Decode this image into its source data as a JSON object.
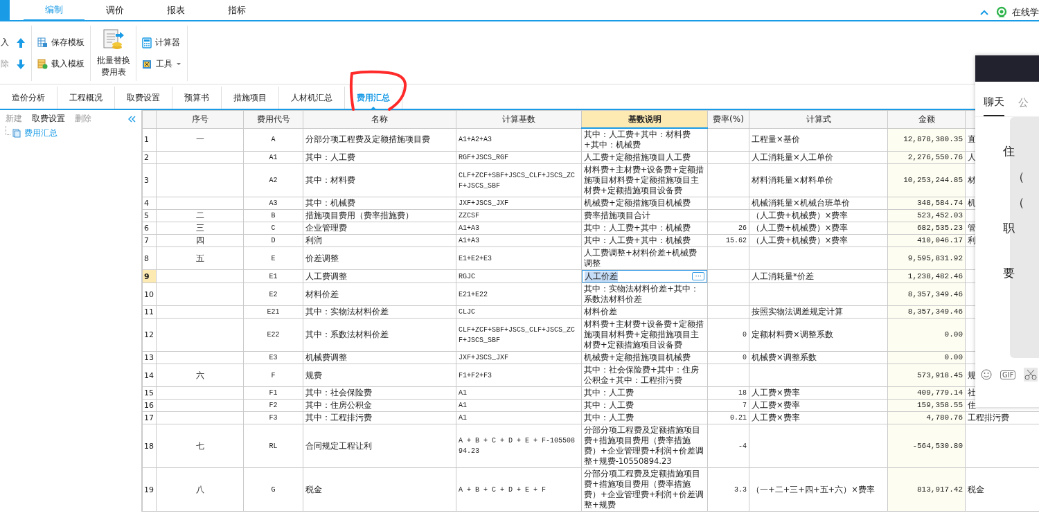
{
  "menu_tabs": [
    {
      "label": "编制",
      "selected": true
    },
    {
      "label": "调价",
      "selected": false
    },
    {
      "label": "报表",
      "selected": false
    },
    {
      "label": "指标",
      "selected": false
    }
  ],
  "online_label": "在线学",
  "toolbar": {
    "insert": {
      "label": "入",
      "disabled": false
    },
    "delete": {
      "label": "除",
      "disabled": true
    },
    "save_template": "保存模板",
    "load_template": "载入模板",
    "batch_replace": [
      "批量替换",
      "费用表"
    ],
    "calculator": "计算器",
    "tools": "工具"
  },
  "view_tabs": [
    {
      "label": "造价分析",
      "selected": false
    },
    {
      "label": "工程概况",
      "selected": false
    },
    {
      "label": "取费设置",
      "selected": false
    },
    {
      "label": "预算书",
      "selected": false
    },
    {
      "label": "措施项目",
      "selected": false
    },
    {
      "label": "人材机汇总",
      "selected": false
    },
    {
      "label": "费用汇总",
      "selected": true
    }
  ],
  "left_panel": {
    "actions": [
      {
        "label": "新建",
        "disabled": true
      },
      {
        "label": "取费设置",
        "disabled": false
      },
      {
        "label": "删除",
        "disabled": true
      }
    ],
    "tree": [
      {
        "label": "费用汇总",
        "selected": true
      }
    ]
  },
  "table": {
    "more_button_label": "···",
    "columns": [
      {
        "label": "序号",
        "selected": false
      },
      {
        "label": "费用代号",
        "selected": false
      },
      {
        "label": "名称",
        "selected": false
      },
      {
        "label": "计算基数",
        "selected": false
      },
      {
        "label": "基数说明",
        "selected": true
      },
      {
        "label": "费率(%)",
        "selected": false
      },
      {
        "label": "计算式",
        "selected": false
      },
      {
        "label": "金额",
        "selected": false
      }
    ],
    "rows": [
      {
        "no": "1",
        "seq": "一",
        "code": "A",
        "name": "分部分项工程费及定额措施项目费",
        "base": "A1+A2+A3",
        "base_desc": "其中：人工费+其中：材料费+其中：机械费",
        "formula": "工程量×基价",
        "amount": "12,878,380.35",
        "column_9": "直",
        "selected": false
      },
      {
        "no": "2",
        "code": "A1",
        "name": "其中：人工费",
        "base": "RGF+JSCS_RGF",
        "base_desc": "人工费+定额措施项目人工费",
        "formula": "人工消耗量×人工单价",
        "amount": "2,276,550.76",
        "column_9": "人",
        "selected": false
      },
      {
        "no": "3",
        "code": "A2",
        "name": "其中：材料费",
        "base": "CLF+ZCF+SBF+JSCS_CLF+JSCS_ZCF+JSCS_SBF",
        "base_desc": "材料费+主材费+设备费+定额措施项目材料费+定额措施项目主材费+定额措施项目设备费",
        "formula": "材料消耗量×材料单价",
        "amount": "10,253,244.85",
        "column_9": "材",
        "selected": false
      },
      {
        "no": "4",
        "code": "A3",
        "name": "其中：机械费",
        "base": "JXF+JSCS_JXF",
        "base_desc": "机械费+定额措施项目机械费",
        "formula": "机械消耗量×机械台班单价",
        "amount": "348,584.74",
        "column_9": "机",
        "selected": false
      },
      {
        "no": "5",
        "seq": "二",
        "code": "B",
        "name": "措施项目费用（费率措施费）",
        "base": "ZZCSF",
        "base_desc": "费率措施项目合计",
        "formula": "（人工费+机械费）×费率",
        "amount": "523,452.03",
        "selected": false
      },
      {
        "no": "6",
        "seq": "三",
        "code": "C",
        "name": "企业管理费",
        "base": "A1+A3",
        "base_desc": "其中：人工费+其中：机械费",
        "rate": "26",
        "formula": "（人工费+机械费）×费率",
        "amount": "682,535.23",
        "column_9": "管",
        "selected": false
      },
      {
        "no": "7",
        "seq": "四",
        "code": "D",
        "name": "利润",
        "base": "A1+A3",
        "base_desc": "其中：人工费+其中：机械费",
        "rate": "15.62",
        "formula": "（人工费+机械费）×费率",
        "amount": "410,046.17",
        "column_9": "利",
        "selected": false
      },
      {
        "no": "8",
        "seq": "五",
        "code": "E",
        "name": "价差调整",
        "base": "E1+E2+E3",
        "base_desc": "人工费调整+材料价差+机械费调整",
        "amount": "9,595,831.92",
        "selected": false
      },
      {
        "no": "9",
        "code": "E1",
        "name": "人工费调整",
        "base": "RGJC",
        "base_desc": "人工价差",
        "formula": "人工消耗量*价差",
        "amount": "1,238,482.46",
        "selected": true
      },
      {
        "no": "10",
        "code": "E2",
        "name": "材料价差",
        "base": "E21+E22",
        "base_desc": "其中：实物法材料价差+其中：系数法材料价差",
        "amount": "8,357,349.46",
        "selected": false
      },
      {
        "no": "11",
        "code": "E21",
        "name": "其中：实物法材料价差",
        "base": "CLJC",
        "base_desc": "材料价差",
        "formula": "按照实物法调差规定计算",
        "amount": "8,357,349.46",
        "selected": false
      },
      {
        "no": "12",
        "code": "E22",
        "name": "其中：系数法材料价差",
        "base": "CLF+ZCF+SBF+JSCS_CLF+JSCS_ZCF+JSCS_SBF",
        "base_desc": "材料费+主材费+设备费+定额措施项目材料费+定额措施项目主材费+定额措施项目设备费",
        "rate": "0",
        "formula": "定额材料费×调整系数",
        "amount": "0.00",
        "selected": false
      },
      {
        "no": "13",
        "code": "E3",
        "name": "机械费调整",
        "base": "JXF+JSCS_JXF",
        "base_desc": "机械费+定额措施项目机械费",
        "rate": "0",
        "formula": "机械费×调整系数",
        "amount": "0.00",
        "selected": false
      },
      {
        "no": "14",
        "seq": "六",
        "code": "F",
        "name": "规费",
        "base": "F1+F2+F3",
        "base_desc": "其中：社会保险费+其中：住房公积金+其中：工程排污费",
        "amount": "573,918.45",
        "column_9": "规",
        "selected": false
      },
      {
        "no": "15",
        "code": "F1",
        "name": "其中：社会保险费",
        "base": "A1",
        "base_desc": "其中：人工费",
        "rate": "18",
        "formula": "人工费×费率",
        "amount": "409,779.14",
        "column_9": "社",
        "selected": false
      },
      {
        "no": "16",
        "code": "F2",
        "name": "其中：住房公积金",
        "base": "A1",
        "base_desc": "其中：人工费",
        "rate": "7",
        "formula": "人工费×费率",
        "amount": "159,358.55",
        "column_9": "住",
        "selected": false
      },
      {
        "no": "17",
        "code": "F3",
        "name": "其中：工程排污费",
        "base": "A1",
        "base_desc": "其中：人工费",
        "rate": "0.21",
        "formula": "人工费×费率",
        "amount": "4,780.76",
        "column_9": "工程排污费",
        "selected": false
      },
      {
        "no": "18",
        "seq": "七",
        "code": "RL",
        "name": "合同规定工程让利",
        "base": "A + B + C + D + E + F-10550894.23",
        "base_desc": "分部分项工程费及定额措施项目费+措施项目费用（费率措施费）+企业管理费+利润+价差调整+规费-10550894.23",
        "rate": "-4",
        "amount": "-564,530.80",
        "selected": false
      },
      {
        "no": "19",
        "seq": "八",
        "code": "G",
        "name": "税金",
        "base": "A + B + C + D + E + F",
        "base_desc": "分部分项工程费及定额措施项目费+措施项目费用（费率措施费）+企业管理费+利润+价差调整+规费",
        "rate": "3.3",
        "formula": "（一+二+三+四+五+六）×费率",
        "amount": "813,917.42",
        "column_9": "税金",
        "selected": false
      }
    ]
  },
  "chat_panel": {
    "tabs": [
      {
        "label": "聊天",
        "selected": true
      },
      {
        "label": "公",
        "selected": false
      }
    ],
    "message_lines": [
      "住",
      "（",
      "（",
      "职",
      "要"
    ],
    "gif_label": "GIF"
  }
}
